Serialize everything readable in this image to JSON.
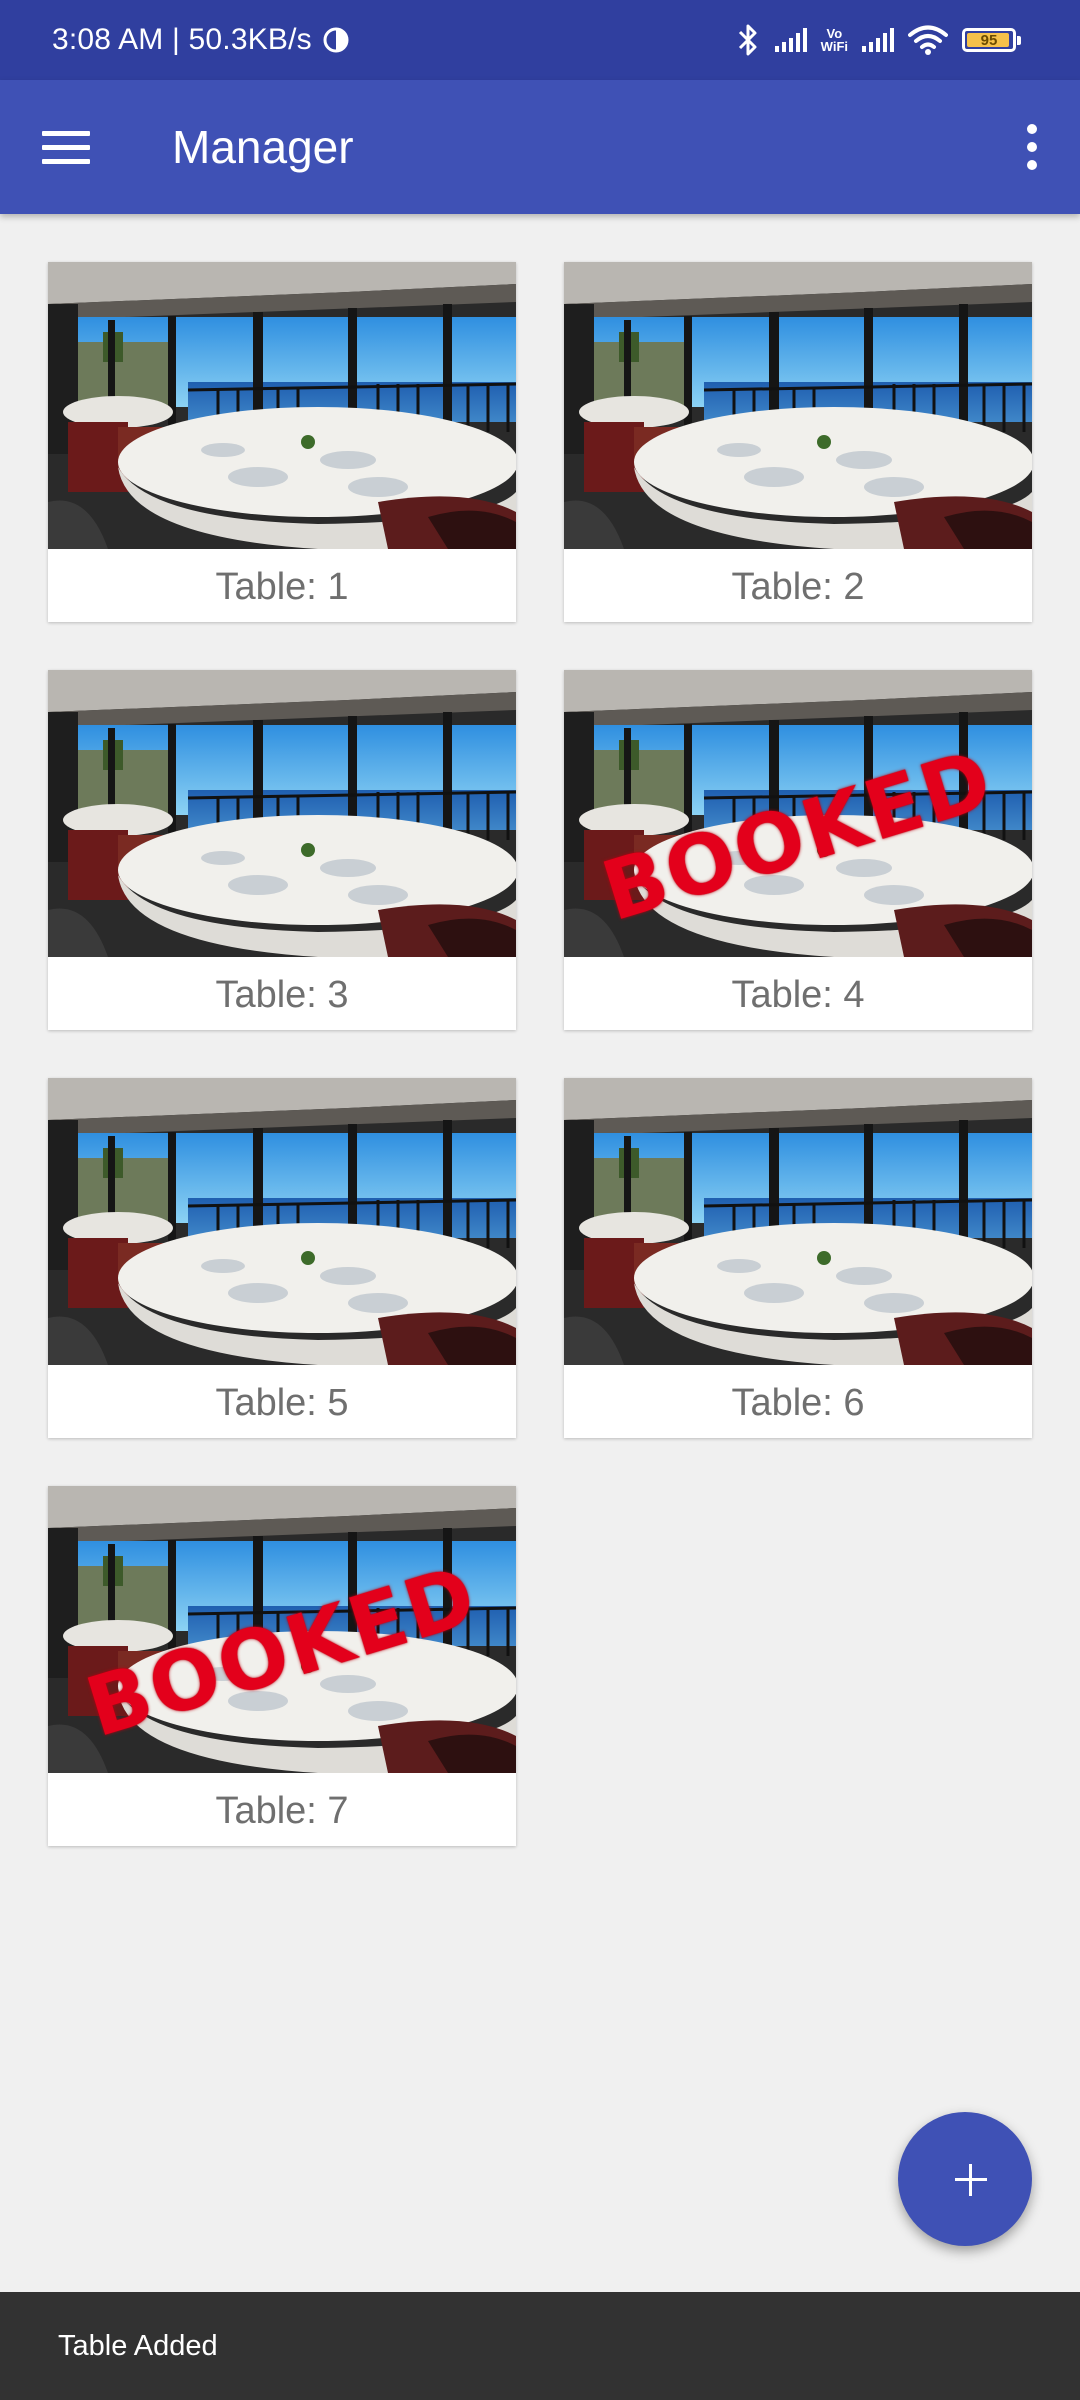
{
  "status_bar": {
    "time_speed": "3:08 AM | 50.3KB/s",
    "battery": "95",
    "vowifi_top": "Vo",
    "vowifi_bottom": "WiFi"
  },
  "app_bar": {
    "title": "Manager",
    "menu_icon": "hamburger-menu-icon",
    "more_icon": "more-vert-icon"
  },
  "tables": [
    {
      "label": "Table: 1",
      "booked": false
    },
    {
      "label": "Table: 2",
      "booked": false
    },
    {
      "label": "Table: 3",
      "booked": false
    },
    {
      "label": "Table: 4",
      "booked": true
    },
    {
      "label": "Table: 5",
      "booked": false
    },
    {
      "label": "Table: 6",
      "booked": false
    },
    {
      "label": "Table: 7",
      "booked": true
    }
  ],
  "booked_stamp": "BOOKED",
  "fab": {
    "icon": "add-icon"
  },
  "snackbar": {
    "message": "Table Added"
  },
  "colors": {
    "primary": "#3f51b5",
    "primary_dark": "#303f9f",
    "booked_red": "#e3001b"
  }
}
